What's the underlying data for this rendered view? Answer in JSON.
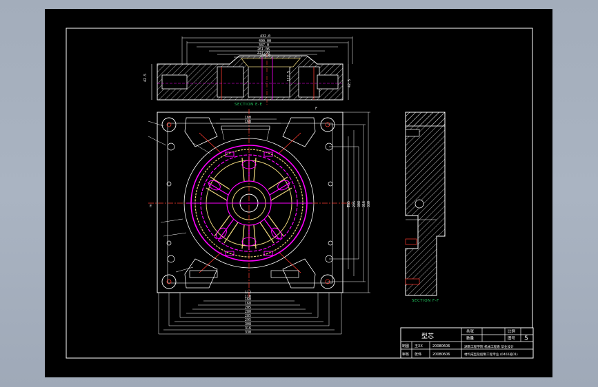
{
  "colors": {
    "background": "#000000",
    "outline": "#ffffff",
    "cavity": "#ff00ff",
    "part": "#e8d27a",
    "section_label": "#22c55e",
    "dimension": "#ffffff",
    "center_line": "#ff3b30",
    "hatch": "#ffffff",
    "cyan": "#00e5ff"
  },
  "views": {
    "top_section_label": "SECTION E-E",
    "right_section_label": "SECTION F-F",
    "top_dims": [
      "432.0",
      "400.00",
      "347.0",
      "261.06",
      "237.00",
      "150.0"
    ],
    "bottom_dims": [
      "280",
      "168",
      "160",
      "205",
      "285",
      "295",
      "308",
      "316",
      "330"
    ],
    "right_dims": [
      "330",
      "316",
      "308",
      "295",
      "285"
    ],
    "upper_inner_dims": [
      "160",
      "168"
    ],
    "lower_inner_dims": [
      "112",
      "110"
    ],
    "side_dims": [
      "112.5",
      "42.5",
      "42.5"
    ],
    "left_mark": "E",
    "right_mark": "E",
    "corner_mark": "F"
  },
  "title_block": {
    "part_name": "型芯",
    "scale_label": "比例",
    "scale_value": "",
    "sheet_label": "图号",
    "sheet_value": "5",
    "material_label": "共张",
    "quantity_label": "数量",
    "designer_label": "制图",
    "designer_name": "王XX",
    "designer_date": "20080606",
    "checker_label": "审核",
    "checker_name": "张伟",
    "checker_date": "20080606",
    "school_line1": "湖南工程学院 机械工程系 毕业设计",
    "school_line2": "材料成型及控制工程专业 (0402班01)"
  }
}
